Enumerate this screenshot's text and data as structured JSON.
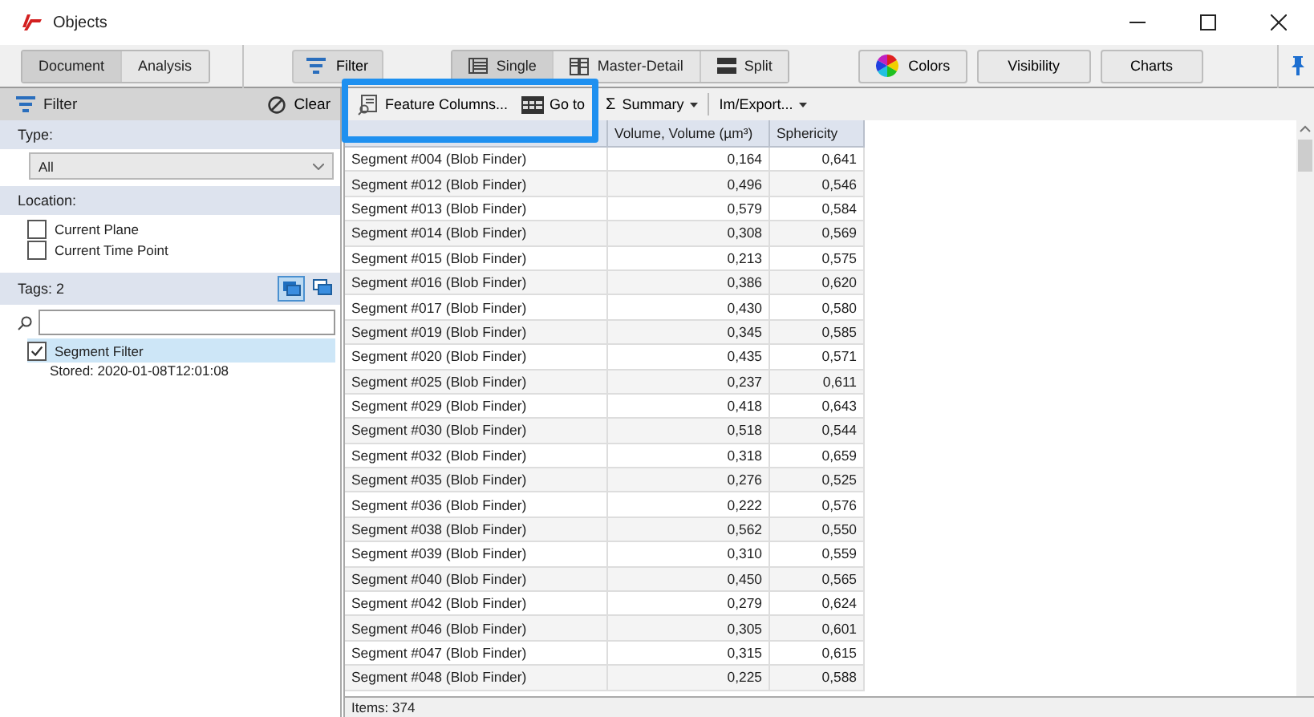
{
  "window": {
    "title": "Objects"
  },
  "toolbar": {
    "view_tabs": [
      {
        "label": "Document",
        "selected": true
      },
      {
        "label": "Analysis",
        "selected": false
      }
    ],
    "filter_button": "Filter",
    "layouts": [
      {
        "label": "Single",
        "selected": true,
        "kind": "single"
      },
      {
        "label": "Master-Detail",
        "selected": false,
        "kind": "master"
      },
      {
        "label": "Split",
        "selected": false,
        "kind": "split"
      }
    ],
    "buttons": [
      {
        "label": "Colors",
        "kind": "colors"
      },
      {
        "label": "Visibility",
        "kind": "plain"
      },
      {
        "label": "Charts",
        "kind": "plain"
      }
    ]
  },
  "filter_panel": {
    "title": "Filter",
    "clear": "Clear",
    "type_label": "Type:",
    "type_value": "All",
    "location_label": "Location:",
    "location_options": [
      {
        "label": "Current Plane",
        "checked": false
      },
      {
        "label": "Current Time Point",
        "checked": false
      }
    ],
    "tags_label": "Tags: 2",
    "tags": [
      {
        "label": "Segment Filter",
        "checked": true,
        "selected": true,
        "detail": "Stored: 2020-01-08T12:01:08"
      }
    ]
  },
  "grid_toolbar": [
    {
      "label": "Feature Columns...",
      "kind": "columns",
      "highlighted": true
    },
    {
      "label": "Go to",
      "kind": "goto",
      "highlighted": true
    },
    {
      "label": "Summary",
      "kind": "summary",
      "highlighted": false,
      "symbol": "Σ"
    },
    {
      "label": "Im/Export...",
      "kind": "export",
      "highlighted": false
    }
  ],
  "table": {
    "columns": [
      "",
      "Volume, Volume (µm³)",
      "Sphericity"
    ],
    "rows": [
      [
        "Segment #004 (Blob Finder)",
        "0,164",
        "0,641"
      ],
      [
        "Segment #012 (Blob Finder)",
        "0,496",
        "0,546"
      ],
      [
        "Segment #013 (Blob Finder)",
        "0,579",
        "0,584"
      ],
      [
        "Segment #014 (Blob Finder)",
        "0,308",
        "0,569"
      ],
      [
        "Segment #015 (Blob Finder)",
        "0,213",
        "0,575"
      ],
      [
        "Segment #016 (Blob Finder)",
        "0,386",
        "0,620"
      ],
      [
        "Segment #017 (Blob Finder)",
        "0,430",
        "0,580"
      ],
      [
        "Segment #019 (Blob Finder)",
        "0,345",
        "0,585"
      ],
      [
        "Segment #020 (Blob Finder)",
        "0,435",
        "0,571"
      ],
      [
        "Segment #025 (Blob Finder)",
        "0,237",
        "0,611"
      ],
      [
        "Segment #029 (Blob Finder)",
        "0,418",
        "0,643"
      ],
      [
        "Segment #030 (Blob Finder)",
        "0,518",
        "0,544"
      ],
      [
        "Segment #032 (Blob Finder)",
        "0,318",
        "0,659"
      ],
      [
        "Segment #035 (Blob Finder)",
        "0,276",
        "0,525"
      ],
      [
        "Segment #036 (Blob Finder)",
        "0,222",
        "0,576"
      ],
      [
        "Segment #038 (Blob Finder)",
        "0,562",
        "0,550"
      ],
      [
        "Segment #039 (Blob Finder)",
        "0,310",
        "0,559"
      ],
      [
        "Segment #040 (Blob Finder)",
        "0,450",
        "0,565"
      ],
      [
        "Segment #042 (Blob Finder)",
        "0,279",
        "0,624"
      ],
      [
        "Segment #046 (Blob Finder)",
        "0,305",
        "0,601"
      ],
      [
        "Segment #047 (Blob Finder)",
        "0,315",
        "0,615"
      ],
      [
        "Segment #048 (Blob Finder)",
        "0,225",
        "0,588"
      ]
    ]
  },
  "status_bar": "Items: 374"
}
